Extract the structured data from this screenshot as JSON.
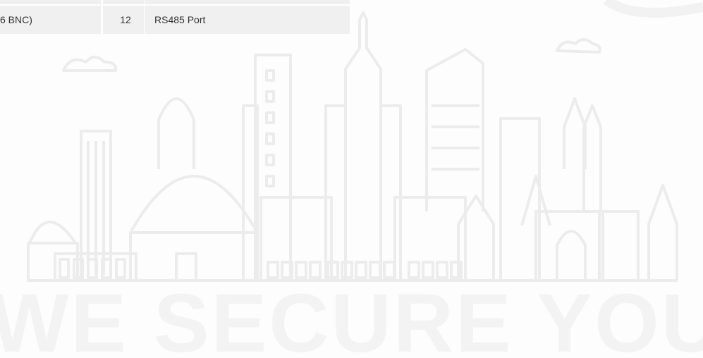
{
  "spec_table": {
    "rows": [
      {
        "col1": "6 BNC)",
        "col2": "12",
        "col3": "RS485 Port"
      }
    ]
  },
  "background": {
    "slogan": "WE SECURE YOUR LIFE",
    "skyline_color": "#eeeeee",
    "slogan_color": "#f3f3f3"
  }
}
